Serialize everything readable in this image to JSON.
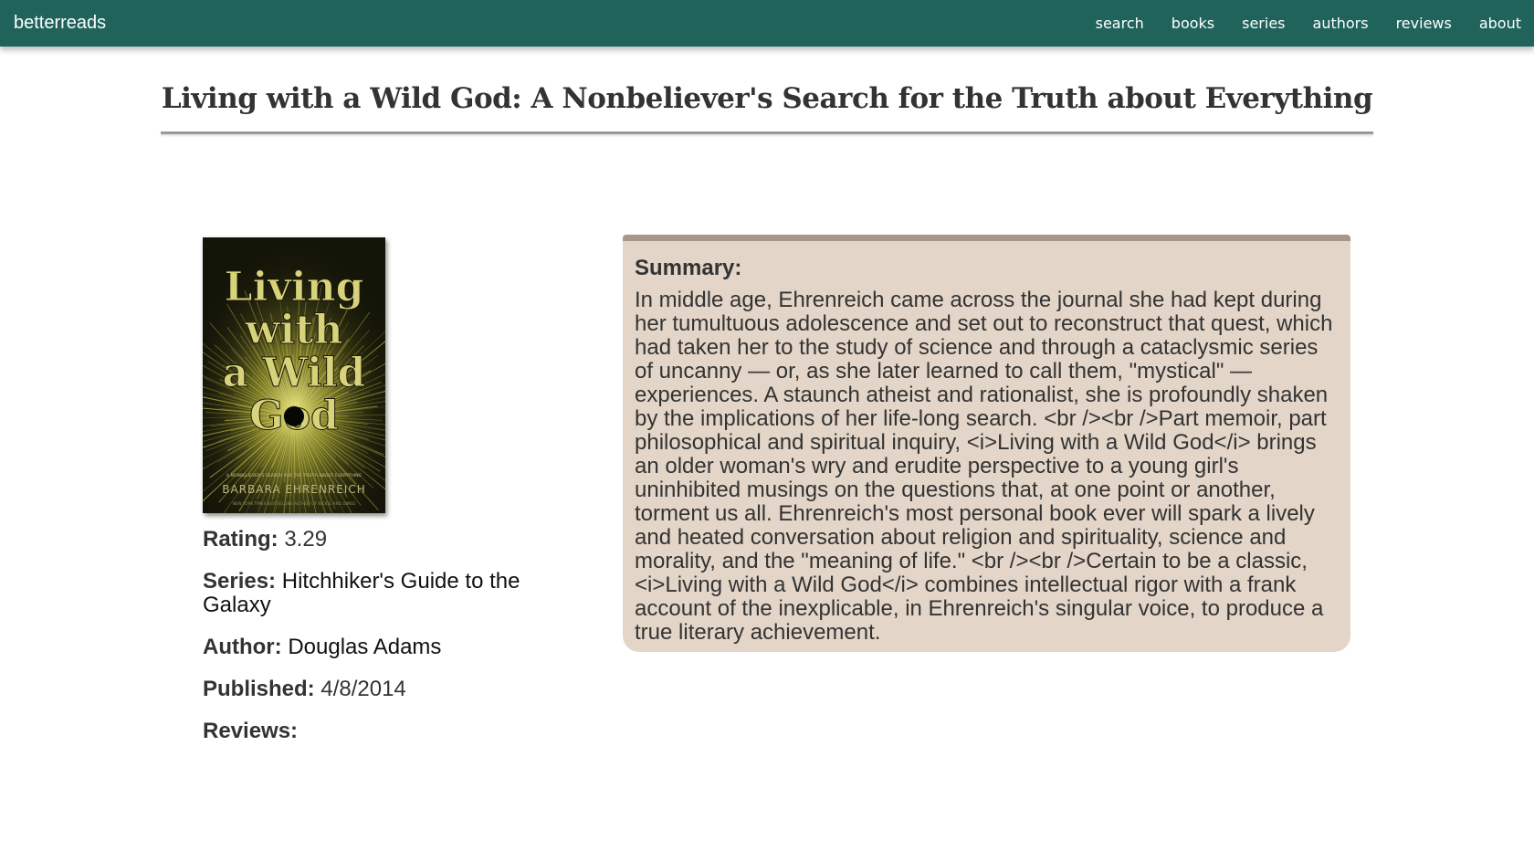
{
  "navbar": {
    "brand": "betterreads",
    "links": [
      "search",
      "books",
      "series",
      "authors",
      "reviews",
      "about"
    ]
  },
  "book": {
    "title": "Living with a Wild God: A Nonbeliever's Search for the Truth about Everything",
    "cover": {
      "title_lines": [
        "Living",
        "with",
        "a Wild",
        "God"
      ],
      "subtitle": "A NONBELIEVER'S SEARCH FOR THE TRUTH ABOUT EVERYTHING",
      "author": "BARBARA EHRENREICH",
      "tagline": "NEW YORK TIMES BESTSELLING AUTHOR OF NICKEL AND DIMED",
      "colors": {
        "background": "#141509",
        "rays": "#c9c64a",
        "text": "#d8d27a"
      }
    },
    "details": {
      "rating_label": "Rating:",
      "rating_value": "3.29",
      "series_label": "Series:",
      "series_value": "Hitchhiker's Guide to the Galaxy",
      "author_label": "Author:",
      "author_value": "Douglas Adams",
      "published_label": "Published:",
      "published_value": "4/8/2014",
      "reviews_label": "Reviews:"
    },
    "summary": {
      "heading": "Summary:",
      "text": "In middle age, Ehrenreich came across the journal she had kept during her tumultuous adolescence and set out to reconstruct that quest, which had taken her to the study of science and through a cataclysmic series of uncanny — or, as she later learned to call them, \"mystical\" — experiences. A staunch atheist and rationalist, she is profoundly shaken by the implications of her life-long search. <br /><br />Part memoir, part philosophical and spiritual inquiry, <i>Living with a Wild God</i> brings an older woman's wry and erudite perspective to a young girl's uninhibited musings on the questions that, at one point or another, torment us all. Ehrenreich's most personal book ever will spark a lively and heated conversation about religion and spirituality, science and morality, and the \"meaning of life.\" <br /><br />Certain to be a classic, <i>Living with a Wild God</i> combines intellectual rigor with a frank account of the inexplicable, in Ehrenreich's singular voice, to produce a true literary achievement."
    }
  },
  "colors": {
    "navbar": "#20635b",
    "summary_bg": "#e3d5c7",
    "summary_border": "#a69786"
  }
}
